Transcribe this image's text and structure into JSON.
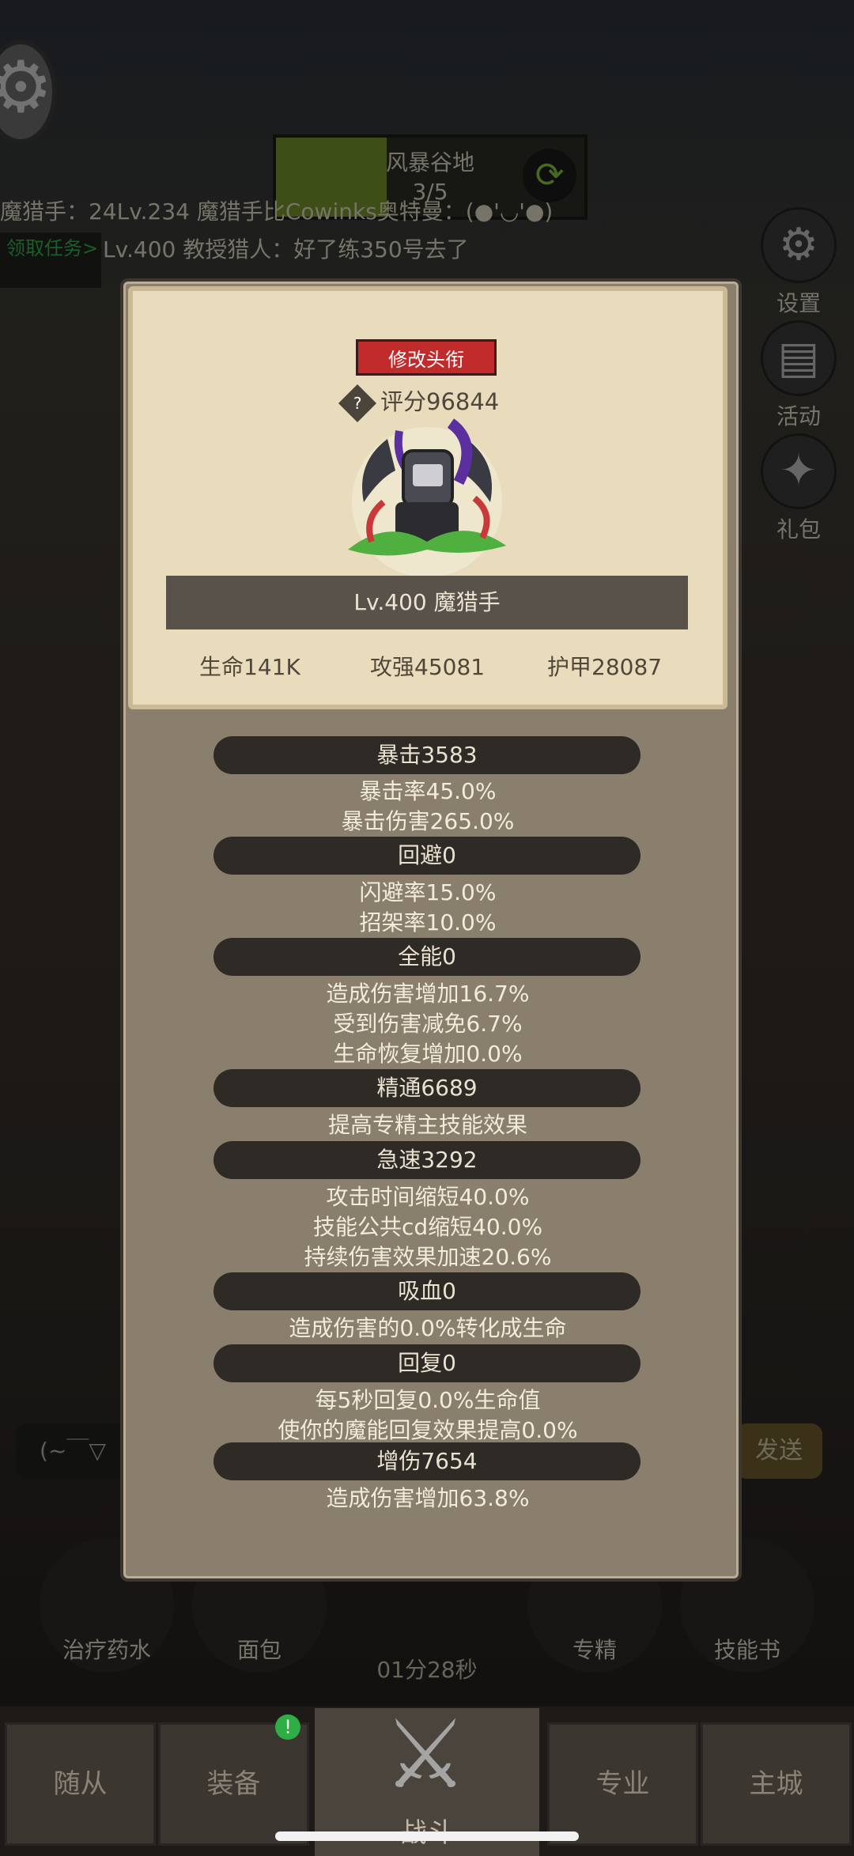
{
  "hud": {
    "area_name": "风暴谷地",
    "area_progress": "3/5",
    "chat_line1": "魔猎手：24Lv.234 魔猎手比Cowinks奥特曼：(●'◡'●)",
    "task_button": "领取任务>",
    "chat_line2": "Lv.400 教授猎人：好了练350号去了",
    "side_buttons": [
      {
        "label": "设置",
        "icon": "gear-icon"
      },
      {
        "label": "活动",
        "icon": "calendar-icon"
      },
      {
        "label": "礼包",
        "icon": "gift-icon"
      }
    ]
  },
  "card": {
    "title_button": "修改头衔",
    "score": "评分96844",
    "level_name": "Lv.400 魔猎手",
    "hp": "生命141K",
    "attack": "攻强45081",
    "armor": "护甲28087"
  },
  "sections": [
    {
      "header": "暴击3583",
      "lines": [
        "暴击率45.0%",
        "暴击伤害265.0%"
      ]
    },
    {
      "header": "回避0",
      "lines": [
        "闪避率15.0%",
        "招架率10.0%"
      ]
    },
    {
      "header": "全能0",
      "lines": [
        "造成伤害增加16.7%",
        "受到伤害减免6.7%",
        "生命恢复增加0.0%"
      ]
    },
    {
      "header": "精通6689",
      "lines": [
        "提高专精主技能效果"
      ]
    },
    {
      "header": "急速3292",
      "lines": [
        "攻击时间缩短40.0%",
        "技能公共cd缩短40.0%",
        "持续伤害效果加速20.6%"
      ]
    },
    {
      "header": "吸血0",
      "lines": [
        "造成伤害的0.0%转化成生命"
      ]
    },
    {
      "header": "回复0",
      "lines": [
        "每5秒回复0.0%生命值",
        "使你的魔能回复效果提高0.0%"
      ]
    },
    {
      "header": "增伤7654",
      "lines": [
        "造成伤害增加63.8%"
      ]
    }
  ],
  "bottom": {
    "chat_input": "(~￣▽",
    "send": "发送",
    "skills": [
      "治疗药水",
      "面包",
      "专精",
      "技能书"
    ],
    "timer": "01分28秒"
  },
  "nav": {
    "items": [
      "随从",
      "装备",
      "战斗",
      "专业",
      "主城"
    ]
  }
}
